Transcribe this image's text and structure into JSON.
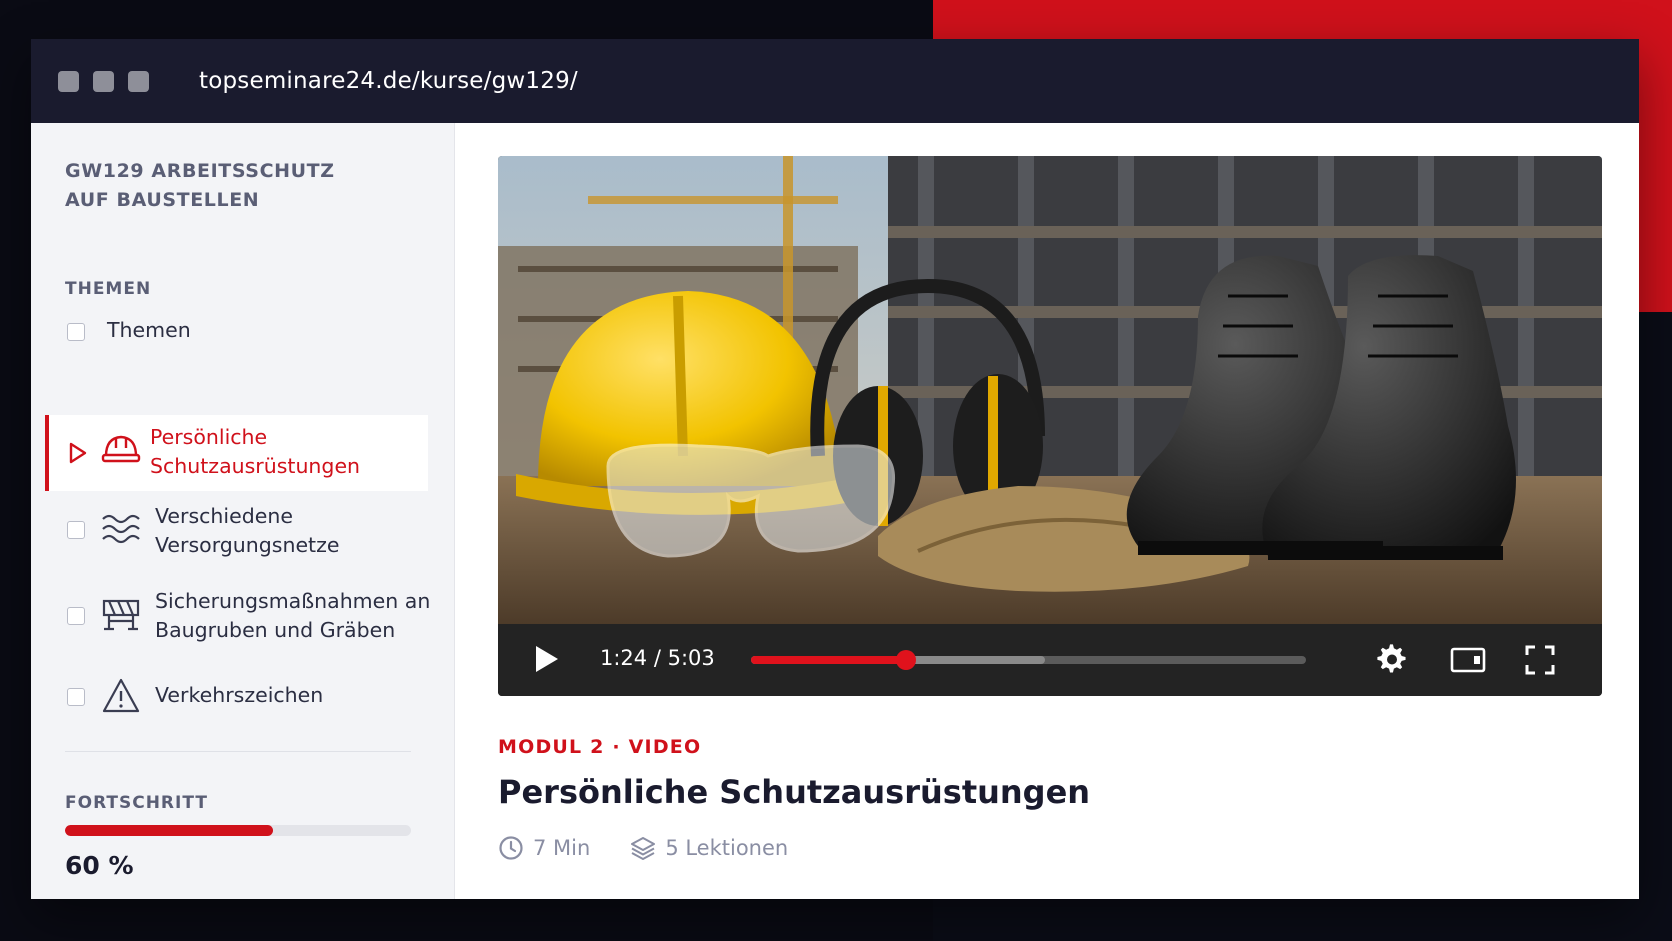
{
  "browser": {
    "url": "topseminare24.de/kurse/gw129/"
  },
  "sidebar": {
    "course_title": "GW129 ARBEITSSCHUTZ AUF BAUSTELLEN",
    "section_label": "THEMEN",
    "items": [
      {
        "label": "Themen",
        "icon": "none",
        "state": "unchecked"
      },
      {
        "label": "Persönliche Schutzausrüstungen",
        "icon": "hard-hat-icon",
        "state": "active"
      },
      {
        "label": "Verschiedene Versorgungsnetze",
        "icon": "waves-icon",
        "state": "unchecked"
      },
      {
        "label": "Sicherungsmaßnahmen an Baugruben und Gräben",
        "icon": "barrier-icon",
        "state": "unchecked"
      },
      {
        "label": "Verkehrszeichen",
        "icon": "warning-triangle-icon",
        "state": "unchecked"
      }
    ],
    "progress_label": "FORTSCHRITT",
    "progress_value": "60 %",
    "progress_fraction": 0.6
  },
  "player": {
    "time_display": "1:24 / 5:03",
    "played_fraction": 0.28,
    "buffered_fraction": 0.53,
    "icons": [
      "play-icon",
      "settings-gear-icon",
      "theater-mode-icon",
      "fullscreen-icon"
    ]
  },
  "lesson": {
    "kicker": "MODUL 2 · VIDEO",
    "title": "Persönliche Schutzausrüstungen",
    "duration": "7 Min",
    "lessons": "5 Lektionen"
  },
  "colors": {
    "accent": "#d0111b",
    "titlebar": "#1a1b2e",
    "sidebar_bg": "#f3f4f7",
    "text_dark": "#1a1b2e",
    "text_muted": "#8a8ea3"
  }
}
